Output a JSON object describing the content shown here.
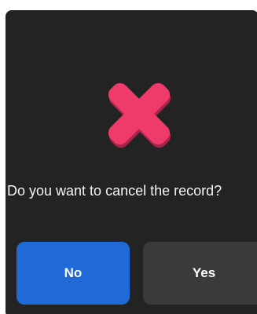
{
  "dialog": {
    "icon": "cancel-x-icon",
    "question": "Do you want to cancel the record?",
    "buttons": {
      "no_label": "No",
      "yes_label": "Yes"
    }
  },
  "colors": {
    "background": "#232323",
    "icon_pink": "#ef3b6a",
    "icon_shadow": "#a8244a",
    "no_button": "#1f6ad6",
    "yes_button": "#3a3a3a",
    "text": "#f4f4f4"
  }
}
